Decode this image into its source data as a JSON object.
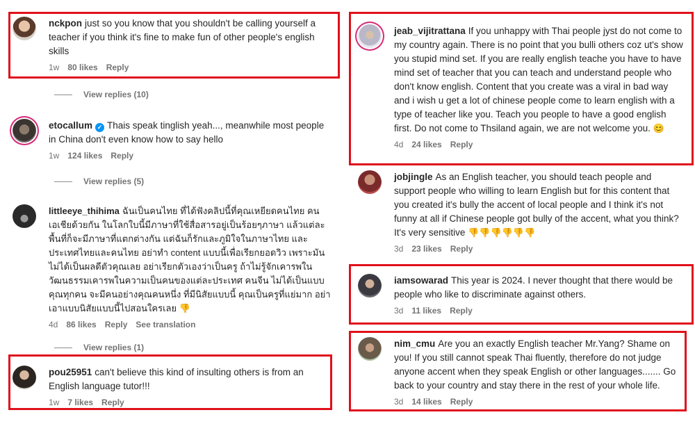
{
  "left": {
    "c1": {
      "username": "nckpon",
      "text": "just so you know that you shouldn't be calling yourself a teacher if you think it's fine to make fun of other people's english skills",
      "time": "1w",
      "likes": "80 likes",
      "reply": "Reply"
    },
    "vr1": "View replies (10)",
    "c2": {
      "username": "etocallum",
      "text": "Thais speak tinglish yeah..., meanwhile most people in China don't even know how to say hello",
      "time": "1w",
      "likes": "124 likes",
      "reply": "Reply"
    },
    "vr2": "View replies (5)",
    "c3": {
      "username": "littleeye_thihima",
      "text": "ฉันเป็นคนไทย ที่ได้ฟังคลิปนี้ที่คุณเหยียดคนไทย คนเอเชียด้วยกัน ในโลกใบนี้มีภาษาที่ใช้สื่อสารอยู่เป็นร้อยๆภาษา แล้วแต่ละพื้นที่ก็จะมีภาษาที่แตกต่างกัน แต่ฉันก็รักและภูมิใจในภาษาไทย และประเทศไทยและคนไทย อย่าทำ content แบบนี้เพื่อเรียกยอดวิว เพราะมันไม่ได้เป็นผลดีตัวคุณเลย อย่าเรียกตัวเองว่าเป็นครู ถ้าไม่รู้จักเคารพในวัฒนธรรมเคารพในความเป็นคนของแต่ละประเทศ คนจีน ไม่ได้เป็นแบบคุณทุกคน จะมีคนอย่างคุณคนหนึ่ง ที่มีนิสัยแบบนี้ คุณเป็นครูที่แย่มาก อย่าเอาแบบนิสัยแบบนี้ไปสอนใครเลย",
      "emoji": "👎",
      "time": "4d",
      "likes": "86 likes",
      "reply": "Reply",
      "translate": "See translation"
    },
    "vr3": "View replies (1)",
    "c4": {
      "username": "pou25951",
      "text": "can't believe this kind of insulting others is from an English language tutor!!!",
      "time": "1w",
      "likes": "7 likes",
      "reply": "Reply"
    }
  },
  "right": {
    "c1": {
      "username": "jeab_vijitrattana",
      "text": "If you unhappy with Thai people jyst do not come to my country again. There is no point that you bulli others coz ut's show you stupid mind set. If you are really english teache you have to have mind set of teacher that you can teach and understand people who don't know english. Content that you create was a viral in bad way and i wish u get a lot of chinese people come to learn english with a type of teacher like you. Teach you people to have a good english first. Do not come to Thsiland again, we are not welcome you.",
      "emoji": "😊",
      "time": "4d",
      "likes": "24 likes",
      "reply": "Reply"
    },
    "c2": {
      "username": "jobjingle",
      "text": "As an English teacher, you should teach people and support people who willing to learn English but for this content that you created it's bully the accent of local people and I think it's not funny at all if Chinese people got bully of the accent, what you think? It's very sensitive",
      "emoji": "👎👎👎👎👎👎",
      "time": "3d",
      "likes": "23 likes",
      "reply": "Reply"
    },
    "c3": {
      "username": "iamsowarad",
      "text": "This year is 2024. I never thought that there would be people who like to discriminate against others.",
      "time": "3d",
      "likes": "11 likes",
      "reply": "Reply"
    },
    "c4": {
      "username": "nim_cmu",
      "text": "Are you an exactly English teacher Mr.Yang? Shame on you! If you still cannot speak Thai fluently, therefore do not judge anyone accent when they speak English or other languages....... Go back to your country and stay there in the rest of your whole life.",
      "time": "3d",
      "likes": "14 likes",
      "reply": "Reply"
    }
  },
  "colors": {
    "highlight": "#e0101b",
    "verified": "#0095f6",
    "muted": "#737373"
  }
}
